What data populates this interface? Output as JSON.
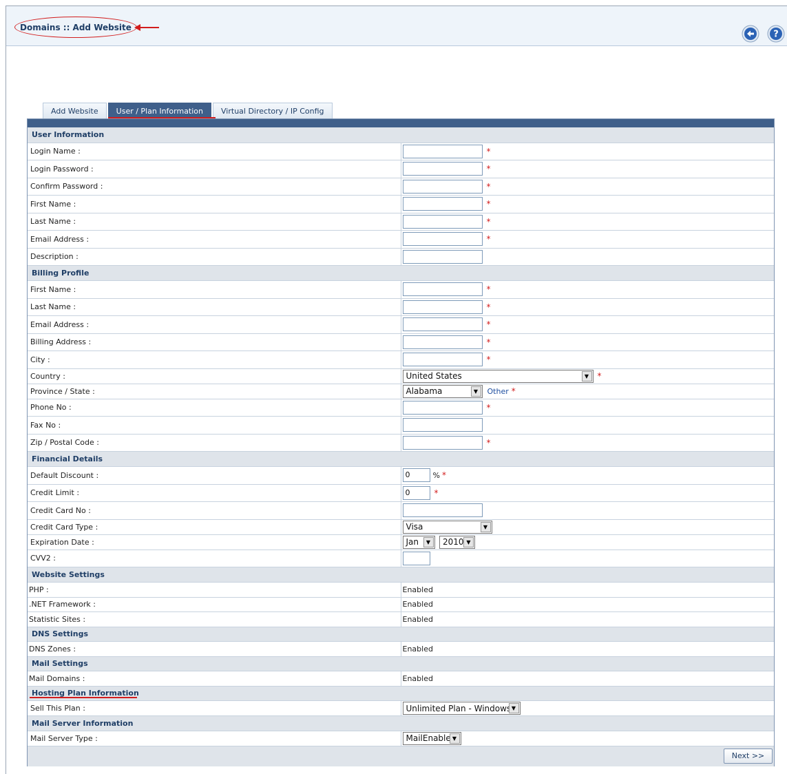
{
  "header": {
    "title": "Domains :: Add Website",
    "back_icon": "back-arrow-icon",
    "help_icon": "help-question-icon",
    "accent_red": "#d21c1c",
    "brand_blue": "#3f5f8a"
  },
  "tabs": [
    {
      "label": "Add Website",
      "active": false
    },
    {
      "label": "User / Plan Information",
      "active": true
    },
    {
      "label": "Virtual Directory / IP Config",
      "active": false
    }
  ],
  "sections": {
    "user_info": "User Information",
    "billing": "Billing Profile",
    "financial": "Financial Details",
    "website": "Website Settings",
    "dns": "DNS Settings",
    "mail": "Mail Settings",
    "hosting": "Hosting Plan Information",
    "mailserver": "Mail Server Information"
  },
  "user": {
    "login_name": "Login Name :",
    "login_password": "Login Password :",
    "confirm_password": "Confirm Password :",
    "first_name": "First Name :",
    "last_name": "Last Name :",
    "email": "Email Address :",
    "description": "Description :"
  },
  "billing": {
    "first_name": "First Name :",
    "last_name": "Last Name :",
    "email": "Email Address :",
    "address": "Billing Address :",
    "city": "City :",
    "country": "Country :",
    "country_value": "United States",
    "state": "Province / State :",
    "state_value": "Alabama",
    "other_link": "Other",
    "phone": "Phone No :",
    "fax": "Fax No :",
    "zip": "Zip / Postal Code :"
  },
  "financial": {
    "discount": "Default Discount :",
    "discount_value": "0",
    "percent": "%",
    "credit_limit": "Credit Limit :",
    "credit_limit_value": "0",
    "card_no": "Credit Card No :",
    "card_type": "Credit Card Type :",
    "card_type_value": "Visa",
    "expiration": "Expiration Date :",
    "exp_month": "Jan",
    "exp_year": "2010",
    "cvv2": "CVV2 :"
  },
  "website": {
    "php": "PHP :",
    "php_value": "Enabled",
    "net": ".NET Framework :",
    "net_value": "Enabled",
    "stats": "Statistic Sites :",
    "stats_value": "Enabled"
  },
  "dns": {
    "zones": "DNS Zones :",
    "zones_value": "Enabled"
  },
  "mail": {
    "domains": "Mail Domains :",
    "domains_value": "Enabled"
  },
  "hosting": {
    "sell_plan": "Sell This Plan :",
    "sell_plan_value": "Unlimited Plan - Windows"
  },
  "mailserver": {
    "type": "Mail Server Type :",
    "type_value": "MailEnable"
  },
  "required_marker": "*",
  "next_button": "Next >>"
}
